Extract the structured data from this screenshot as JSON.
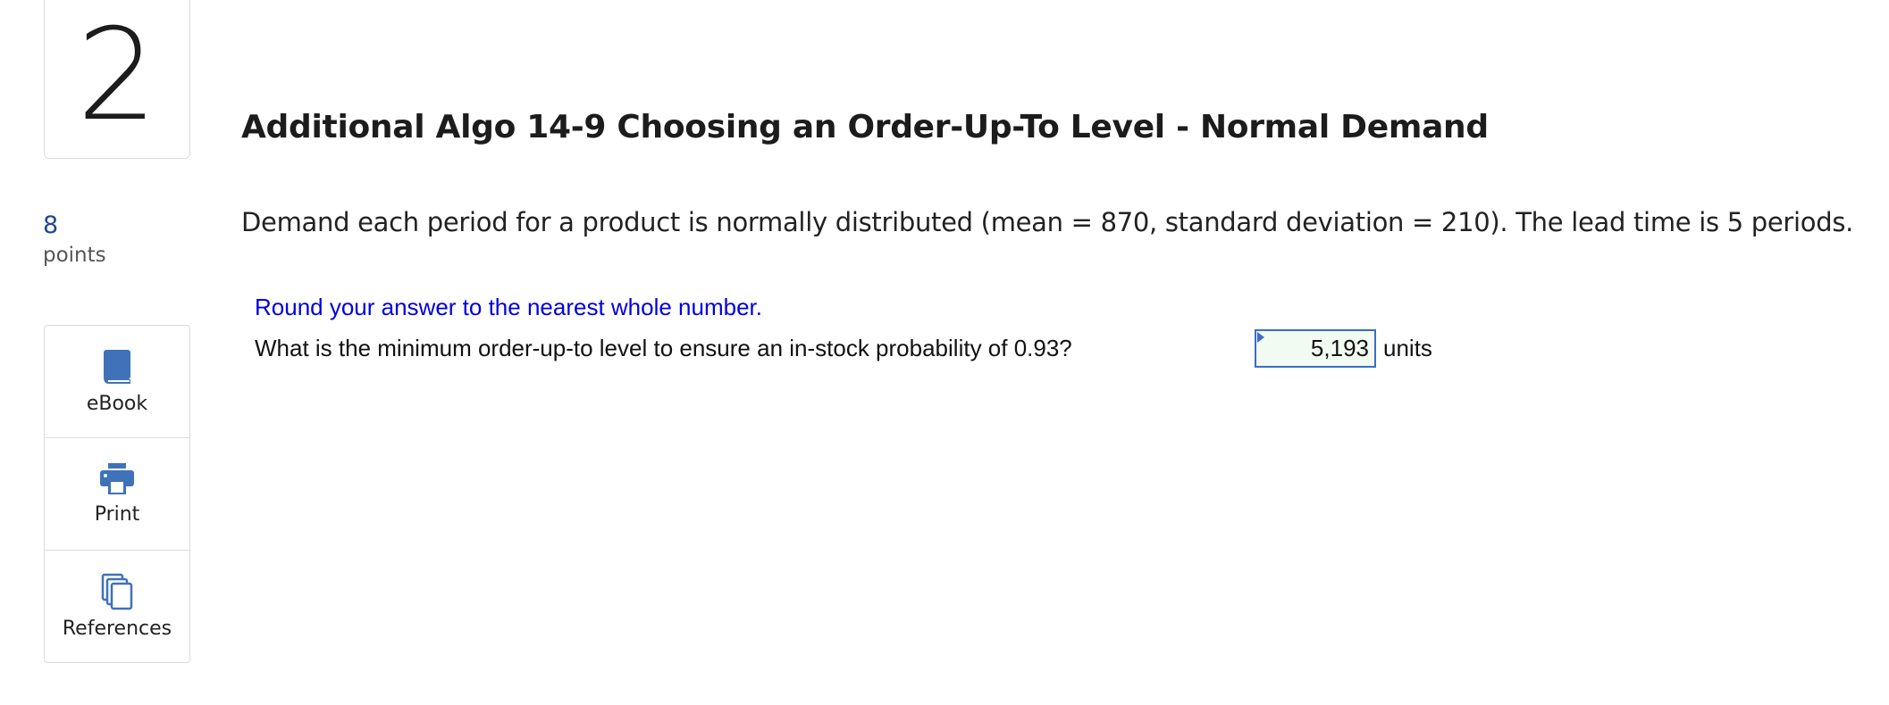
{
  "question": {
    "number": "2",
    "points_value": "8",
    "points_label": "points",
    "title": "Additional Algo 14-9 Choosing an Order-Up-To Level - Normal Demand",
    "prompt": "Demand each period for a product is normally distributed (mean = 870, standard deviation = 210). The lead time is 5 periods.",
    "instruction": "Round your answer to the nearest whole number.",
    "ask": "What is the minimum order-up-to level to ensure an in-stock probability of 0.93?",
    "answer_value": "5,193",
    "answer_unit": "units"
  },
  "tools": {
    "ebook": {
      "label": "eBook",
      "icon": "book-icon"
    },
    "print": {
      "label": "Print",
      "icon": "printer-icon"
    },
    "references": {
      "label": "References",
      "icon": "documents-icon"
    }
  },
  "colors": {
    "accent": "#3a6cc8",
    "instruction_text": "#0000e0",
    "points_value": "#1f4a8a",
    "answer_bg": "#f1fbf1"
  }
}
